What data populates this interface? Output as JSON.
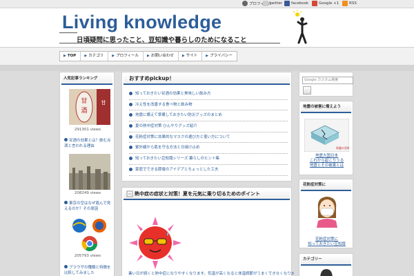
{
  "topbar": {
    "links": [
      {
        "icon": "user-icon",
        "label": "プロフィール"
      },
      {
        "icon": "twitter-icon",
        "label": "twitter"
      },
      {
        "icon": "facebook-icon",
        "label": "facebook"
      },
      {
        "icon": "google-plus-icon",
        "label": "Google +1"
      },
      {
        "icon": "rss-icon",
        "label": "RSS"
      }
    ]
  },
  "header": {
    "title": "Living knowledge",
    "tagline": "日頃疑問に思ったこと、豆知識や暮らしのためになること"
  },
  "nav": {
    "items": [
      "TOP",
      "カテゴリ",
      "プロフィール",
      "お問い合わせ",
      "サイト",
      "プライバシー"
    ]
  },
  "left_sidebar": {
    "heading": "人気記事ランキング",
    "items": [
      {
        "views": "291301 views",
        "title": "甘酒の効果とは？飲む点滴と言われる理由"
      },
      {
        "views": "208249 views",
        "title": "東京の空はなぜ霞んで見えるのか？その原因"
      },
      {
        "views": "205793 views",
        "title": "ブラウザの種類と特徴を比較してみました"
      }
    ]
  },
  "pickup": {
    "heading": "おすすめpickup！",
    "items": [
      "知っておきたい甘酒の効果と美味しい飲み方",
      "冷え性を改善する食べ物と飲み物",
      "地震に備えて準備しておきたい防災グッズのまとめ",
      "夏の熱中症対策 ひんやりグッズ紹介",
      "花粉症対策に効果的なマスクの選び方と使い方について",
      "紫外線から肌を守る方法と日焼け止め",
      "知っておきたい豆知識シリーズ 暮らしのヒント集",
      "家庭でできる節電のアイデアとちょっとした工夫"
    ]
  },
  "article": {
    "title": "熱中症の症状と対策！夏を元気に乗り切るためのポイント",
    "body_start": "暑い日が続くと熱中症になりやすくなります。気温が高くなると体温調節がうまくできなくなり30.7℃"
  },
  "right_sidebar": {
    "search_placeholder": "Google カスタム検索",
    "widget1": {
      "heading": "地震の被害に備えよう",
      "caption": [
        "地震大国日本",
        "これから起こりうる",
        "地震とその被害とは"
      ]
    },
    "widget2": {
      "heading": "花粉症対策に",
      "caption": [
        "花粉症対策に",
        "知っておきたい豆知識"
      ]
    },
    "widget3": {
      "heading": "カテゴリー"
    }
  },
  "colors": {
    "accent": "#2c5d99",
    "background": "#dcdcdc"
  }
}
